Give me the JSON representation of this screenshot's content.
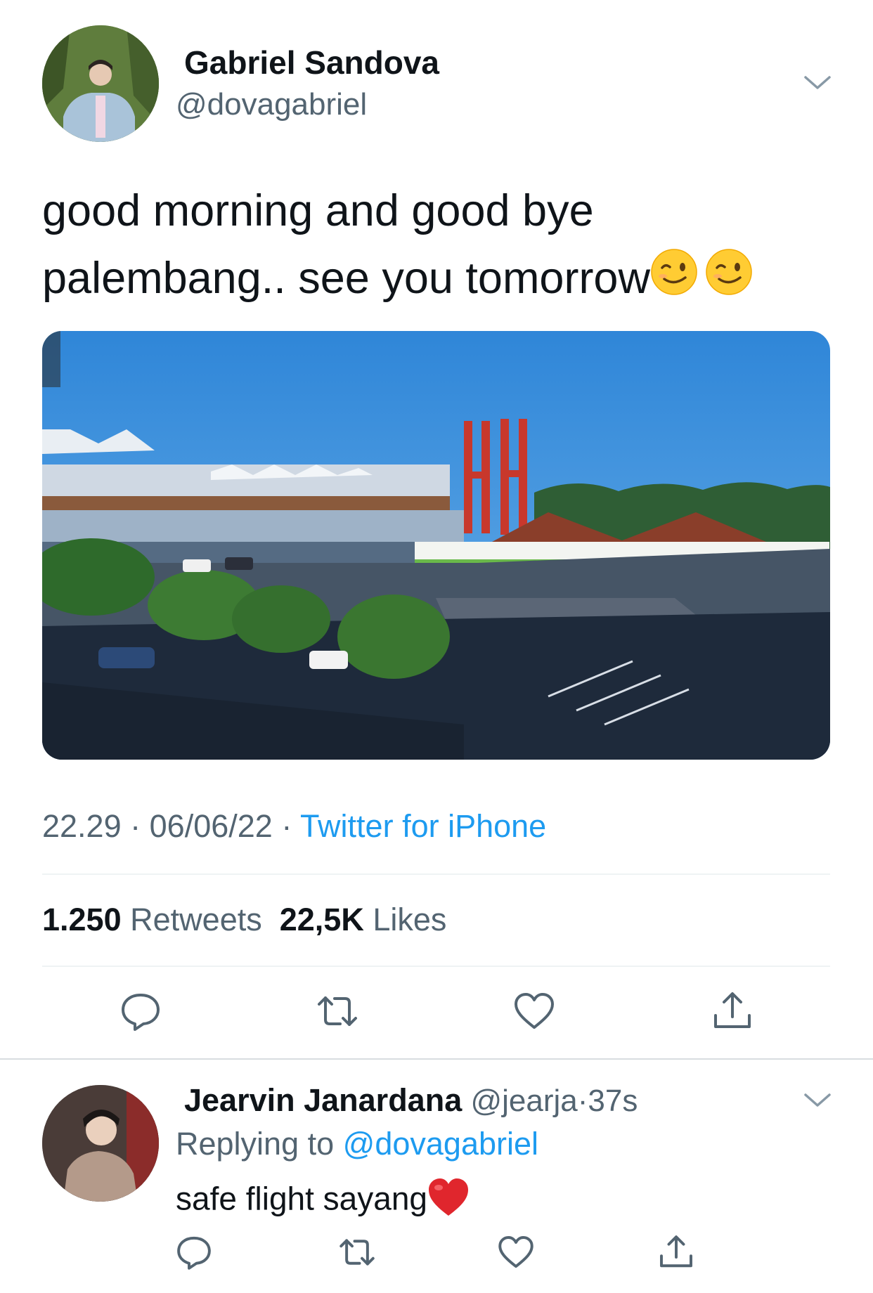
{
  "tweet": {
    "author": {
      "name": "Gabriel Sandova",
      "handle": "@dovagabriel"
    },
    "text_line1": "good morning and good bye",
    "text_line2": "palembang.. see you tomorrow",
    "emojis": [
      "winking-face",
      "winking-face"
    ],
    "time": "22.29",
    "date": "06/06/22",
    "separator": "·",
    "source": "Twitter for iPhone",
    "stats": {
      "retweets_count": "1.250",
      "retweets_label": "Retweets",
      "likes_count": "22,5K",
      "likes_label": "Likes"
    },
    "actions": [
      "reply-icon",
      "retweet-icon",
      "like-icon",
      "share-icon"
    ]
  },
  "reply": {
    "author": {
      "name": "Jearvin Janardana",
      "handle": "@jearja"
    },
    "separator": "·",
    "time": "37s",
    "replying_label": "Replying to",
    "replying_to": "@dovagabriel",
    "text": "safe flight sayang",
    "emoji": "red-heart"
  },
  "colors": {
    "text": "#0f1419",
    "secondary": "#536471",
    "link": "#1d9bf0",
    "divider": "#eff3f4"
  }
}
